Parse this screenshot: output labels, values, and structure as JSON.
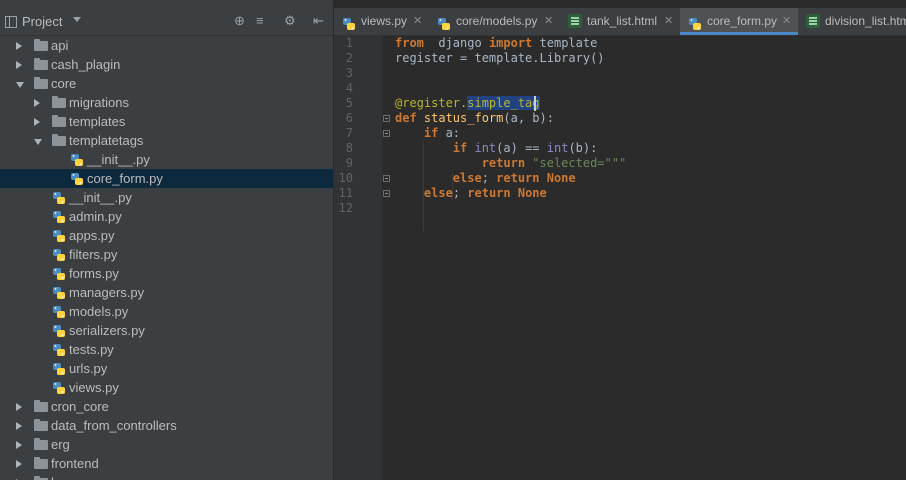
{
  "panel": {
    "title": "Project",
    "tools": [
      "target-icon",
      "collapse-all-icon",
      "gear-icon",
      "hide-panel-icon"
    ]
  },
  "tree": [
    {
      "name": "api",
      "type": "folder",
      "state": "closed",
      "depth": 0
    },
    {
      "name": "cash_plagin",
      "type": "folder",
      "state": "closed",
      "depth": 0
    },
    {
      "name": "core",
      "type": "folder",
      "state": "open",
      "depth": 0
    },
    {
      "name": "migrations",
      "type": "folder",
      "state": "closed",
      "depth": 1
    },
    {
      "name": "templates",
      "type": "folder",
      "state": "closed",
      "depth": 1
    },
    {
      "name": "templatetags",
      "type": "folder",
      "state": "open",
      "depth": 1
    },
    {
      "name": "__init__.py",
      "type": "py",
      "depth": 2
    },
    {
      "name": "core_form.py",
      "type": "py",
      "depth": 2,
      "selected": true
    },
    {
      "name": "__init__.py",
      "type": "py",
      "depth": 1
    },
    {
      "name": "admin.py",
      "type": "py",
      "depth": 1
    },
    {
      "name": "apps.py",
      "type": "py",
      "depth": 1
    },
    {
      "name": "filters.py",
      "type": "py",
      "depth": 1
    },
    {
      "name": "forms.py",
      "type": "py",
      "depth": 1
    },
    {
      "name": "managers.py",
      "type": "py",
      "depth": 1
    },
    {
      "name": "models.py",
      "type": "py",
      "depth": 1
    },
    {
      "name": "serializers.py",
      "type": "py",
      "depth": 1
    },
    {
      "name": "tests.py",
      "type": "py",
      "depth": 1
    },
    {
      "name": "urls.py",
      "type": "py",
      "depth": 1
    },
    {
      "name": "views.py",
      "type": "py",
      "depth": 1
    },
    {
      "name": "cron_core",
      "type": "folder",
      "state": "closed",
      "depth": 0
    },
    {
      "name": "data_from_controllers",
      "type": "folder",
      "state": "closed",
      "depth": 0
    },
    {
      "name": "erg",
      "type": "folder",
      "state": "closed",
      "depth": 0
    },
    {
      "name": "frontend",
      "type": "folder",
      "state": "closed",
      "depth": 0
    },
    {
      "name": "home",
      "type": "folder",
      "state": "closed",
      "depth": 0
    }
  ],
  "tabs": [
    {
      "label": "views.py",
      "icon": "python-file-icon",
      "active": false
    },
    {
      "label": "core/models.py",
      "icon": "python-file-icon",
      "active": false
    },
    {
      "label": "tank_list.html",
      "icon": "html-file-icon",
      "active": false
    },
    {
      "label": "core_form.py",
      "icon": "python-file-icon",
      "active": true
    },
    {
      "label": "division_list.html",
      "icon": "html-file-icon",
      "active": false
    }
  ],
  "editor": {
    "line_numbers": [
      "1",
      "2",
      "3",
      "4",
      "5",
      "6",
      "7",
      "8",
      "9",
      "10",
      "11",
      "12"
    ],
    "lines": [
      [
        [
          "kw",
          "from"
        ],
        [
          "",
          "  django "
        ],
        [
          "kw",
          "import"
        ],
        [
          "",
          " template"
        ]
      ],
      [
        [
          "",
          "register = template.Library()"
        ]
      ],
      [],
      [],
      [
        [
          "dec",
          "@register."
        ],
        [
          "dec hl",
          "simple_tag"
        ]
      ],
      [
        [
          "kw",
          "def "
        ],
        [
          "fn",
          "status_form"
        ],
        [
          "",
          "(a, b):"
        ]
      ],
      [
        [
          "",
          "    "
        ],
        [
          "kw",
          "if"
        ],
        [
          "",
          " a:"
        ]
      ],
      [
        [
          "",
          "        "
        ],
        [
          "kw",
          "if "
        ],
        [
          "bi",
          "int"
        ],
        [
          "",
          "(a) == "
        ],
        [
          "bi",
          "int"
        ],
        [
          "",
          "(b):"
        ]
      ],
      [
        [
          "",
          "            "
        ],
        [
          "kw",
          "return "
        ],
        [
          "str",
          "\"selected=\"\"\""
        ]
      ],
      [
        [
          "",
          "        "
        ],
        [
          "kw",
          "else"
        ],
        [
          "",
          "; "
        ],
        [
          "kw",
          "return None"
        ]
      ],
      [
        [
          "",
          "    "
        ],
        [
          "kw",
          "else"
        ],
        [
          "",
          "; "
        ],
        [
          "kw",
          "return None"
        ]
      ],
      []
    ]
  },
  "colors": {
    "panel_bg": "#3c3f41",
    "editor_bg": "#2b2b2b",
    "selection": "#0d293e",
    "keyword": "#cc7832",
    "function": "#ffc66d",
    "decorator": "#bbb529",
    "string": "#6a8759",
    "builtin": "#8888c6"
  }
}
